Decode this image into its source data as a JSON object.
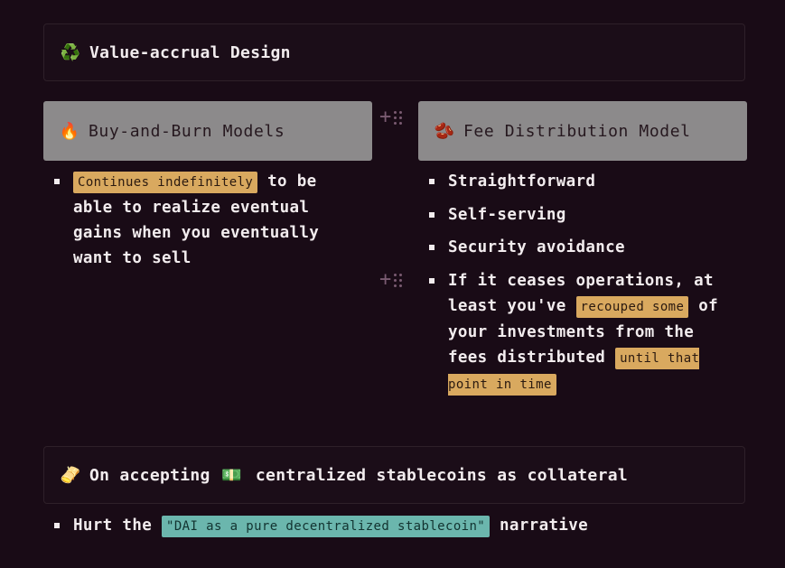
{
  "callout_top": {
    "emoji": "♻️",
    "title": "Value-accrual Design"
  },
  "columns": [
    {
      "emoji": "🔥",
      "header": "Buy-and-Burn Models",
      "bullets": [
        {
          "highlight": "Continues indefinitely",
          "rest": " to be able to realize eventual gains when you eventually want to sell"
        }
      ]
    },
    {
      "emoji": "🫘",
      "header": "Fee Distribution Model",
      "bullets": [
        {
          "text": "Straightforward"
        },
        {
          "text": "Self-serving"
        },
        {
          "text": "Security avoidance"
        },
        {
          "pre": "If it ceases operations, at least you've ",
          "highlight1": "recouped some",
          "mid": " of your investments from the fees distributed ",
          "highlight2": "until that point in time"
        }
      ]
    }
  ],
  "callout_bottom": {
    "emoji": "🫔",
    "pre": "On accepting ",
    "emoji2": "💵",
    "post": " centralized stablecoins as collateral"
  },
  "bottom_bullet": {
    "pre": "Hurt the ",
    "highlight": "\"DAI as a pure decentralized stablecoin\"",
    "post": " narrative"
  },
  "icons": {
    "add_block": "plus-icon",
    "drag_handle": "drag-handle-icon"
  }
}
